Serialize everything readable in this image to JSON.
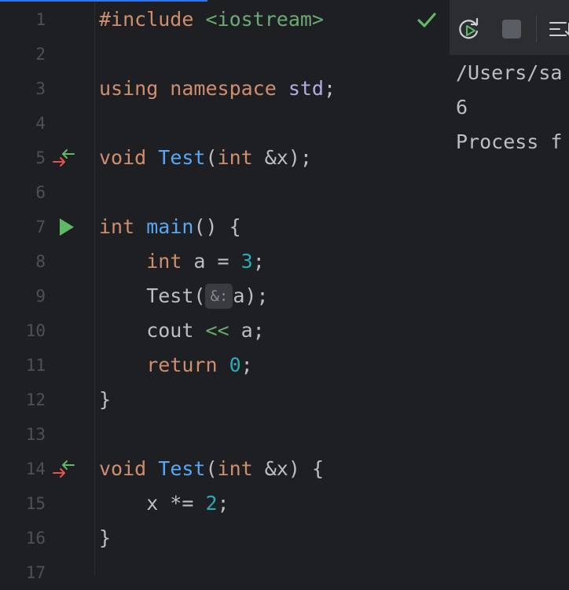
{
  "editor": {
    "lines": [
      {
        "n": "1",
        "parts": [
          [
            "kw",
            "#include "
          ],
          [
            "str",
            "<iostream>"
          ]
        ]
      },
      {
        "n": "2",
        "parts": []
      },
      {
        "n": "3",
        "parts": [
          [
            "kw",
            "using namespace "
          ],
          [
            "ns",
            "std"
          ],
          [
            "",
            ";"
          ]
        ]
      },
      {
        "n": "4",
        "parts": []
      },
      {
        "n": "5",
        "parts": [
          [
            "kw",
            "void "
          ],
          [
            "fn",
            "Test"
          ],
          [
            "",
            "("
          ],
          [
            "kw",
            "int"
          ],
          [
            "",
            " &x);"
          ]
        ]
      },
      {
        "n": "6",
        "parts": []
      },
      {
        "n": "7",
        "parts": [
          [
            "kw",
            "int "
          ],
          [
            "fn",
            "main"
          ],
          [
            "",
            "() {"
          ]
        ]
      },
      {
        "n": "8",
        "parts": [
          [
            "",
            "    "
          ],
          [
            "kw",
            "int"
          ],
          [
            "",
            " a = "
          ],
          [
            "num",
            "3"
          ],
          [
            "",
            ";"
          ]
        ]
      },
      {
        "n": "9",
        "parts": [
          [
            "",
            "    Test("
          ],
          [
            "hint",
            "&:"
          ],
          [
            "",
            "a);"
          ]
        ]
      },
      {
        "n": "10",
        "parts": [
          [
            "",
            "    cout "
          ],
          [
            "op",
            "<<"
          ],
          [
            "",
            " a;"
          ]
        ]
      },
      {
        "n": "11",
        "parts": [
          [
            "",
            "    "
          ],
          [
            "kw",
            "return "
          ],
          [
            "num",
            "0"
          ],
          [
            "",
            ";"
          ]
        ]
      },
      {
        "n": "12",
        "parts": [
          [
            "",
            "}"
          ]
        ]
      },
      {
        "n": "13",
        "parts": []
      },
      {
        "n": "14",
        "parts": [
          [
            "kw",
            "void "
          ],
          [
            "fn",
            "Test"
          ],
          [
            "",
            "("
          ],
          [
            "kw",
            "int"
          ],
          [
            "",
            " &x) {"
          ]
        ]
      },
      {
        "n": "15",
        "parts": [
          [
            "",
            "    x *= "
          ],
          [
            "num",
            "2"
          ],
          [
            "",
            ";"
          ]
        ]
      },
      {
        "n": "16",
        "parts": [
          [
            "",
            "}"
          ]
        ]
      },
      {
        "n": "17",
        "parts": []
      }
    ]
  },
  "run_output": {
    "lines": [
      "/Users/sa",
      "6",
      "Process f"
    ]
  },
  "icons": {
    "checkmark": "checkmark-icon",
    "run_gutter": "run-icon",
    "navigate": "navigate-arrows-icon",
    "rerun": "rerun-icon",
    "stop": "stop-icon",
    "scroll": "scroll-to-end-icon"
  },
  "colors": {
    "background": "#1e1f22",
    "keyword": "#cf8e6d",
    "function": "#56a8f5",
    "number": "#2aacb8",
    "string": "#6aab73",
    "accent": "#3574f0"
  }
}
